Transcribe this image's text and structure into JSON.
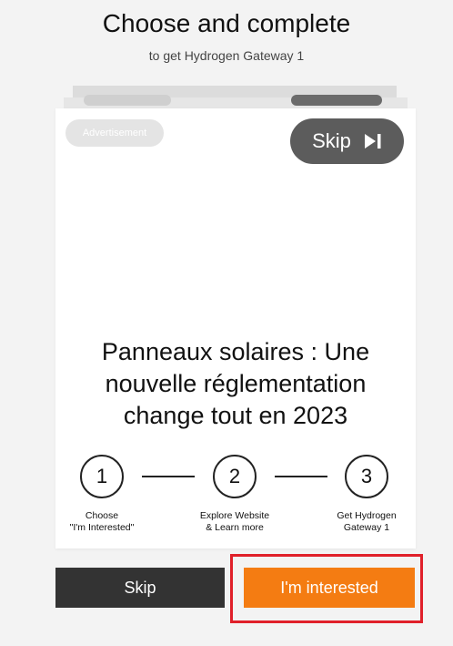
{
  "header": {
    "title": "Choose and complete",
    "subtitle": "to get Hydrogen Gateway 1"
  },
  "card": {
    "ad_badge": "Advertisement",
    "skip_label": "Skip",
    "skip_icon": "skip-next-icon",
    "headline_lines": [
      "Panneaux solaires : Une",
      "nouvelle réglementation",
      "change tout en 2023"
    ]
  },
  "steps": [
    {
      "number": "1",
      "label_line1": "Choose",
      "label_line2": "\"I'm Interested\""
    },
    {
      "number": "2",
      "label_line1": "Explore Website",
      "label_line2": "& Learn more"
    },
    {
      "number": "3",
      "label_line1": "Get Hydrogen",
      "label_line2": "Gateway 1"
    }
  ],
  "actions": {
    "skip_label": "Skip",
    "interested_label": "I'm interested"
  },
  "colors": {
    "accent_orange": "#f47c12",
    "dark_button": "#333333",
    "skip_pill": "#5c5c5c",
    "highlight_red": "#e0202a"
  }
}
